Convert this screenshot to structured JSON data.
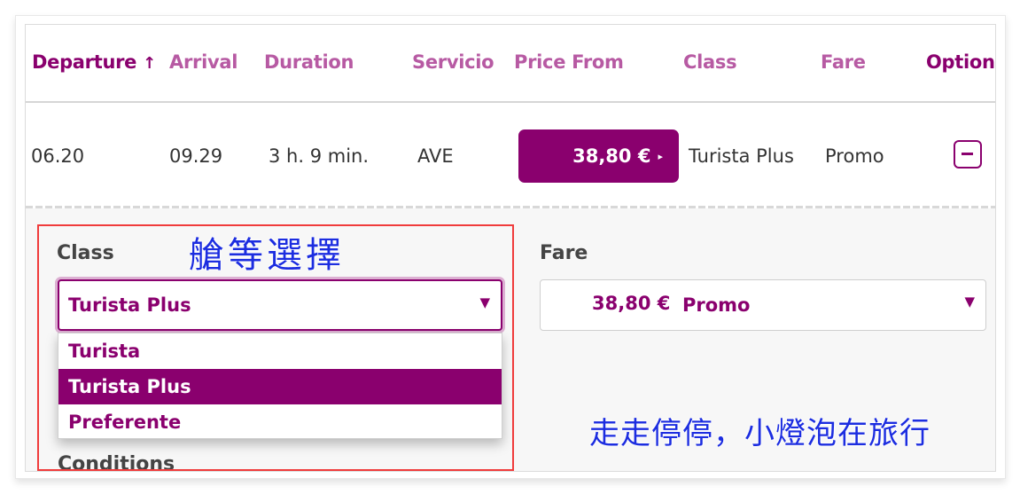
{
  "table": {
    "headers": [
      {
        "label": "Departure",
        "sort_icon": "↑",
        "active": true
      },
      {
        "label": "Arrival"
      },
      {
        "label": "Duration"
      },
      {
        "label": "Servicio"
      },
      {
        "label": "Price From"
      },
      {
        "label": "Class"
      },
      {
        "label": "Fare"
      },
      {
        "label": "Option",
        "active": true
      }
    ],
    "row": {
      "departure": "06.20",
      "arrival": "09.29",
      "duration": "3 h. 9 min.",
      "service": "AVE",
      "price": "38,80 €",
      "price_arrow": "▸",
      "class": "Turista Plus",
      "fare": "Promo"
    }
  },
  "details": {
    "class_label": "Class",
    "class_select": {
      "value": "Turista Plus",
      "caret": "▼",
      "options": [
        {
          "label": "Turista",
          "selected": false
        },
        {
          "label": "Turista Plus",
          "selected": true
        },
        {
          "label": "Preferente",
          "selected": false
        }
      ]
    },
    "fare_label": "Fare",
    "fare_select": {
      "price": "38,80 €",
      "fare": "Promo",
      "caret": "▼"
    },
    "conditions_label": "Conditions"
  },
  "annotations": {
    "title": "艙等選擇",
    "watermark": "走走停停，小燈泡在旅行"
  },
  "colors": {
    "brand": "#8a006e",
    "header_inactive": "#b75aa3",
    "annotation_box": "#f03c3c",
    "annotation_text": "#1c2de0"
  }
}
